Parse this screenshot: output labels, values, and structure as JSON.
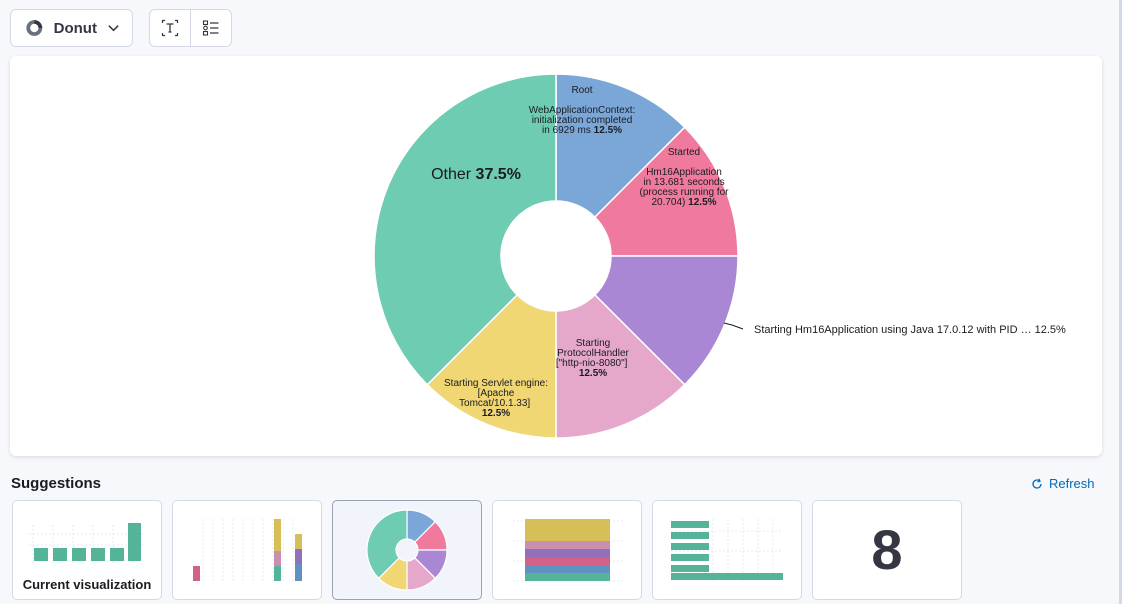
{
  "toolbar": {
    "chart_type_label": "Donut",
    "icons": [
      "donut-chart-icon",
      "chevron-down-icon",
      "text-field-icon",
      "legend-list-icon"
    ]
  },
  "chart_data": {
    "type": "pie",
    "variant": "donut",
    "slices": [
      {
        "lines": [
          "Root",
          "",
          "WebApplicationContext:",
          "initialization completed",
          "in 6929 ms"
        ],
        "percent_label": "12.5%",
        "value": 12.5,
        "color": "#7aa7d8"
      },
      {
        "lines": [
          "Started",
          "",
          "Hm16Application",
          "in 13.681 seconds",
          "(process running for",
          "20.704)"
        ],
        "percent_label": "12.5%",
        "value": 12.5,
        "color": "#f07a9e"
      },
      {
        "lines": [
          "Starting Hm16Application using Java 17.0.12 with PID …"
        ],
        "percent_label": "12.5%",
        "value": 12.5,
        "color": "#a987d4",
        "outside_label": true
      },
      {
        "lines": [
          "Starting",
          "ProtocolHandler",
          "[\"http-nio-8080\"]"
        ],
        "percent_label": "12.5%",
        "value": 12.5,
        "color": "#e5a8ca"
      },
      {
        "lines": [
          "Starting Servlet engine:",
          "[Apache",
          "Tomcat/10.1.33]"
        ],
        "percent_label": "12.5%",
        "value": 12.5,
        "color": "#f0d774"
      },
      {
        "lines": [
          "Other"
        ],
        "percent_label": "37.5%",
        "value": 37.5,
        "color": "#6dccb1"
      }
    ]
  },
  "suggestions": {
    "title": "Suggestions",
    "refresh_label": "Refresh",
    "current_caption": "Current visualization",
    "metric_value": "8"
  },
  "colors": {
    "teal": "#54b399",
    "blue": "#6092c0",
    "pink": "#d36086",
    "purple": "#9170b8",
    "rose": "#ca8eae",
    "yellow": "#d6bf57",
    "link": "#006bb8"
  }
}
